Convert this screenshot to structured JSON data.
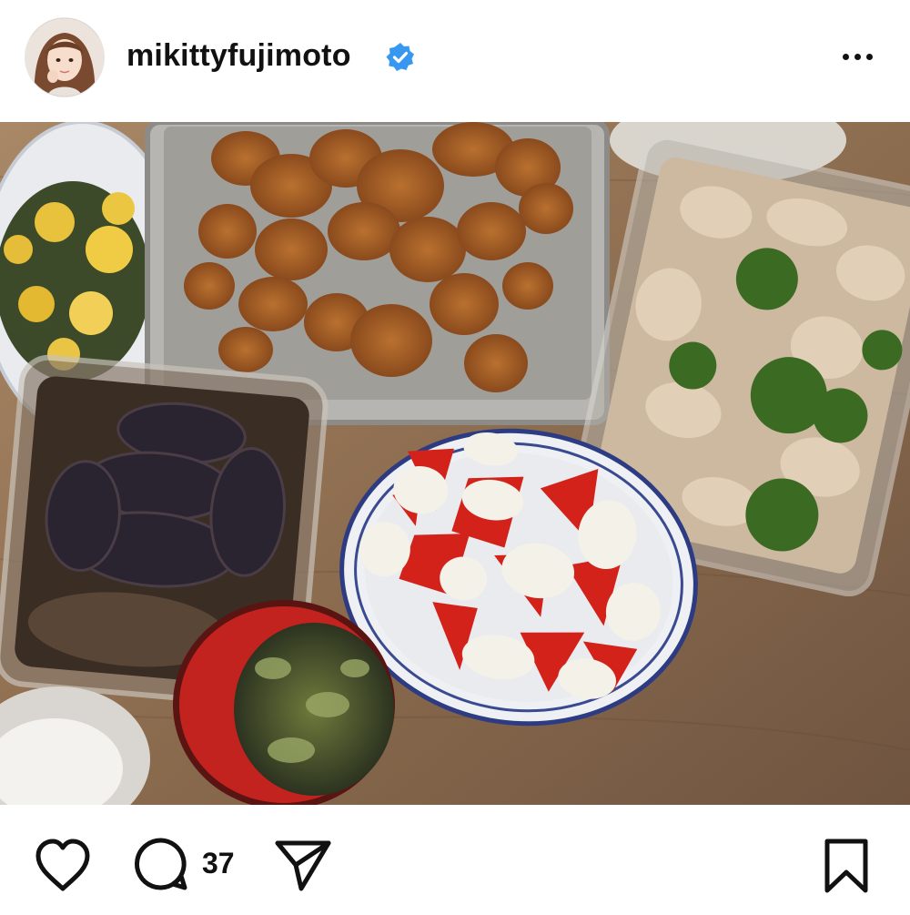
{
  "header": {
    "username": "mikittyfujimoto",
    "verified_icon": "verified-badge-icon",
    "more_icon": "more-options-icon"
  },
  "post": {
    "image_description_icon": "food-photo"
  },
  "actions": {
    "like_icon": "heart-icon",
    "comment_icon": "comment-icon",
    "comment_count": "37",
    "share_icon": "send-icon",
    "save_icon": "bookmark-icon"
  },
  "colors": {
    "verified": "#3897f0",
    "text": "#111111",
    "background": "#ffffff"
  }
}
